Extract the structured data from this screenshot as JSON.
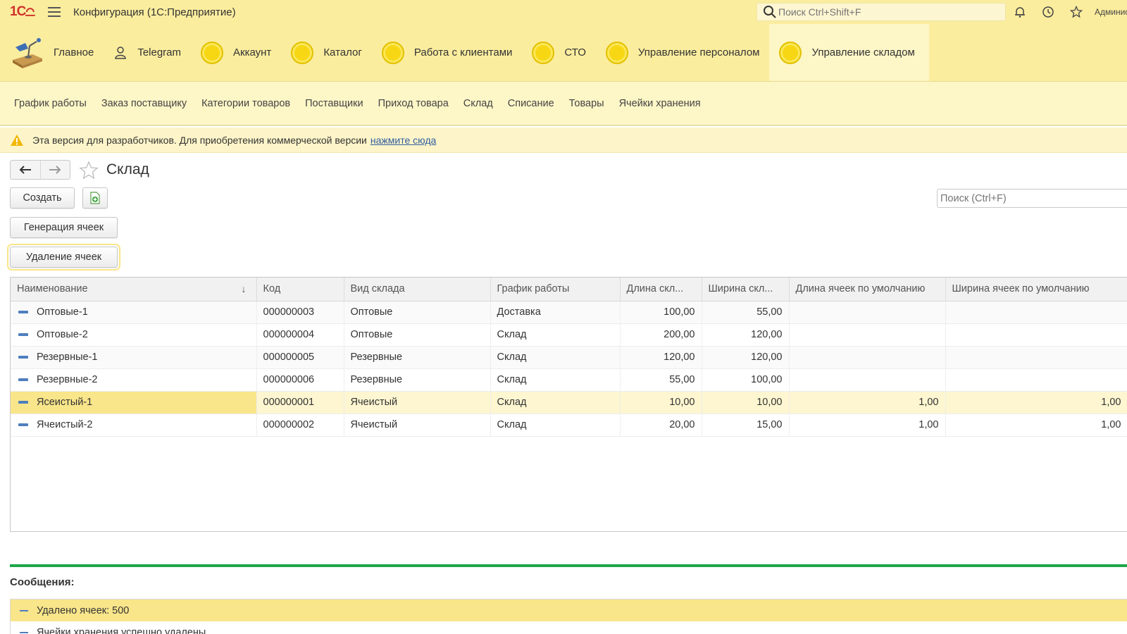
{
  "titlebar": {
    "logo_text": "1С",
    "app_title": "Конфигурация  (1С:Предприятие)",
    "search_placeholder": "Поиск Ctrl+Shift+F",
    "user_name": "Админис"
  },
  "sections": [
    {
      "label": "Главное",
      "icon": "desk-lamp-icon"
    },
    {
      "label": "Telegram",
      "icon": "user-icon"
    },
    {
      "label": "Аккаунт",
      "icon": "yellow-circle-icon"
    },
    {
      "label": "Каталог",
      "icon": "yellow-circle-icon"
    },
    {
      "label": "Работа с клиентами",
      "icon": "yellow-circle-icon"
    },
    {
      "label": "СТО",
      "icon": "yellow-circle-icon"
    },
    {
      "label": "Управление персоналом",
      "icon": "yellow-circle-icon"
    },
    {
      "label": "Управление складом",
      "icon": "yellow-circle-icon",
      "active": true
    }
  ],
  "subsections": [
    "График работы",
    "Заказ поставщику",
    "Категории товаров",
    "Поставщики",
    "Приход товара",
    "Склад",
    "Списание",
    "Товары",
    "Ячейки хранения"
  ],
  "warning": {
    "text": "Эта версия для разработчиков. Для приобретения коммерческой версии",
    "link": "нажмите сюда"
  },
  "form": {
    "title": "Склад",
    "create_label": "Создать",
    "generate_label": "Генерация ячеек",
    "delete_label": "Удаление ячеек",
    "search_placeholder": "Поиск (Ctrl+F)"
  },
  "table": {
    "columns": [
      "Наименование",
      "Код",
      "Вид склада",
      "График работы",
      "Длина скл...",
      "Ширина скл...",
      "Длина ячеек по умолчанию",
      "Ширина ячеек по умолчанию"
    ],
    "rows": [
      {
        "name": "Оптовые-1",
        "code": "000000003",
        "type": "Оптовые",
        "schedule": "Доставка",
        "length": "100,00",
        "width": "55,00",
        "cell_length": "",
        "cell_width": ""
      },
      {
        "name": "Оптовые-2",
        "code": "000000004",
        "type": "Оптовые",
        "schedule": "Склад",
        "length": "200,00",
        "width": "120,00",
        "cell_length": "",
        "cell_width": ""
      },
      {
        "name": "Резервные-1",
        "code": "000000005",
        "type": "Резервные",
        "schedule": "Склад",
        "length": "120,00",
        "width": "120,00",
        "cell_length": "",
        "cell_width": ""
      },
      {
        "name": "Резервные-2",
        "code": "000000006",
        "type": "Резервные",
        "schedule": "Склад",
        "length": "55,00",
        "width": "100,00",
        "cell_length": "",
        "cell_width": ""
      },
      {
        "name": "Ясеистый-1",
        "code": "000000001",
        "type": "Ячеистый",
        "schedule": "Склад",
        "length": "10,00",
        "width": "10,00",
        "cell_length": "1,00",
        "cell_width": "1,00",
        "selected": true
      },
      {
        "name": "Ячеистый-2",
        "code": "000000002",
        "type": "Ячеистый",
        "schedule": "Склад",
        "length": "20,00",
        "width": "15,00",
        "cell_length": "1,00",
        "cell_width": "1,00"
      }
    ]
  },
  "messages": {
    "title": "Сообщения:",
    "items": [
      "Удалено ячеек: 500",
      "Ячейки хранения успешно удалены."
    ]
  },
  "colors": {
    "panel_yellow": "#fbed9e",
    "selection_yellow": "#f9e58a",
    "success_green": "#1ea64b",
    "logo_red": "#d0322b",
    "link_blue": "#315d9e"
  }
}
